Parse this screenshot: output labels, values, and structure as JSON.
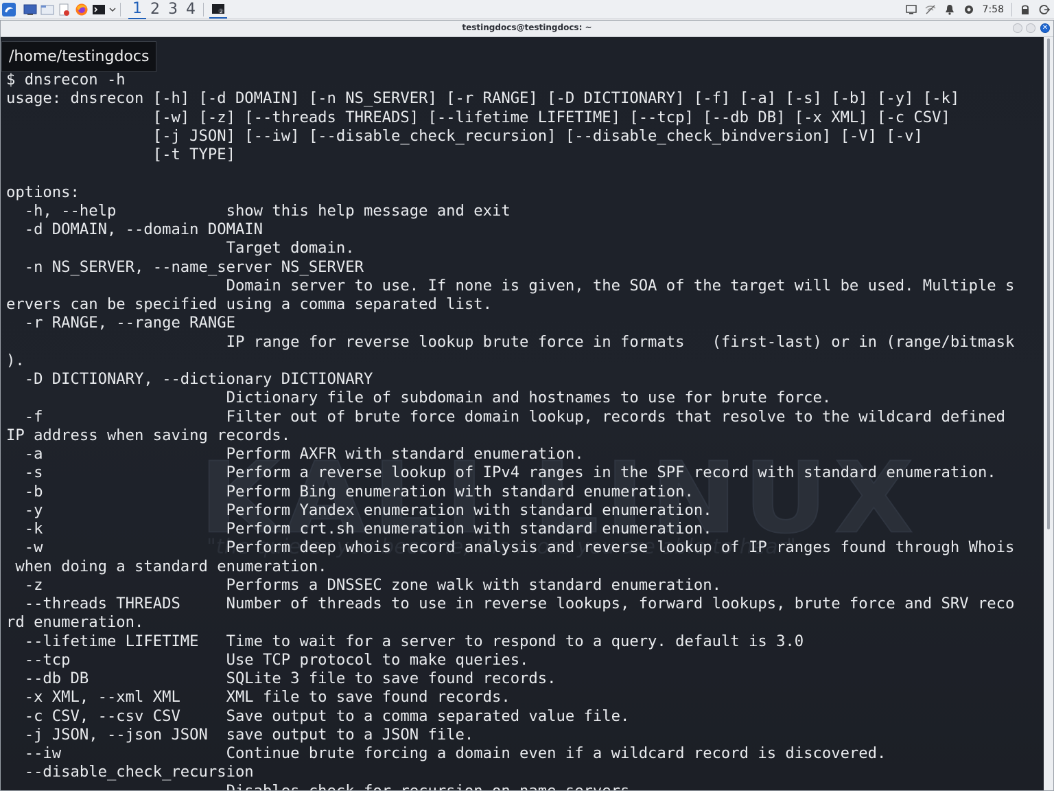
{
  "panel": {
    "workspaces": [
      {
        "label": "1",
        "active": true
      },
      {
        "label": "2",
        "active": false
      },
      {
        "label": "3",
        "active": false
      },
      {
        "label": "4",
        "active": false
      }
    ],
    "clock": "7:58",
    "icons": [
      "kali-menu-icon",
      "desktop-icon",
      "file-manager-icon",
      "text-editor-icon",
      "firefox-icon",
      "terminal-icon",
      "chevron-down-icon",
      "terminal-window-icon"
    ]
  },
  "window": {
    "title": "testingdocs@testingdocs: ~",
    "path_tooltip": "/home/testingdocs"
  },
  "watermark": {
    "brand": "KALI LINUX",
    "tagline": "\"the quieter you become, the more you are able to hear\""
  },
  "terminal": {
    "lines": [
      "$ dnsrecon -h",
      "usage: dnsrecon [-h] [-d DOMAIN] [-n NS_SERVER] [-r RANGE] [-D DICTIONARY] [-f] [-a] [-s] [-b] [-y] [-k]",
      "                [-w] [-z] [--threads THREADS] [--lifetime LIFETIME] [--tcp] [--db DB] [-x XML] [-c CSV]",
      "                [-j JSON] [--iw] [--disable_check_recursion] [--disable_check_bindversion] [-V] [-v]",
      "                [-t TYPE]",
      "",
      "options:",
      "  -h, --help            show this help message and exit",
      "  -d DOMAIN, --domain DOMAIN",
      "                        Target domain.",
      "  -n NS_SERVER, --name_server NS_SERVER",
      "                        Domain server to use. If none is given, the SOA of the target will be used. Multiple s",
      "ervers can be specified using a comma separated list.",
      "  -r RANGE, --range RANGE",
      "                        IP range for reverse lookup brute force in formats   (first-last) or in (range/bitmask",
      ").",
      "  -D DICTIONARY, --dictionary DICTIONARY",
      "                        Dictionary file of subdomain and hostnames to use for brute force.",
      "  -f                    Filter out of brute force domain lookup, records that resolve to the wildcard defined",
      "IP address when saving records.",
      "  -a                    Perform AXFR with standard enumeration.",
      "  -s                    Perform a reverse lookup of IPv4 ranges in the SPF record with standard enumeration.",
      "  -b                    Perform Bing enumeration with standard enumeration.",
      "  -y                    Perform Yandex enumeration with standard enumeration.",
      "  -k                    Perform crt.sh enumeration with standard enumeration.",
      "  -w                    Perform deep whois record analysis and reverse lookup of IP ranges found through Whois",
      " when doing a standard enumeration.",
      "  -z                    Performs a DNSSEC zone walk with standard enumeration.",
      "  --threads THREADS     Number of threads to use in reverse lookups, forward lookups, brute force and SRV reco",
      "rd enumeration.",
      "  --lifetime LIFETIME   Time to wait for a server to respond to a query. default is 3.0",
      "  --tcp                 Use TCP protocol to make queries.",
      "  --db DB               SQLite 3 file to save found records.",
      "  -x XML, --xml XML     XML file to save found records.",
      "  -c CSV, --csv CSV     Save output to a comma separated value file.",
      "  -j JSON, --json JSON  save output to a JSON file.",
      "  --iw                  Continue brute forcing a domain even if a wildcard record is discovered.",
      "  --disable_check_recursion",
      "                        Disables check for recursion on name servers"
    ]
  },
  "colors": {
    "terminal_bg": "#1e2229",
    "terminal_fg": "#e9ebee",
    "accent": "#1f5fb8"
  }
}
